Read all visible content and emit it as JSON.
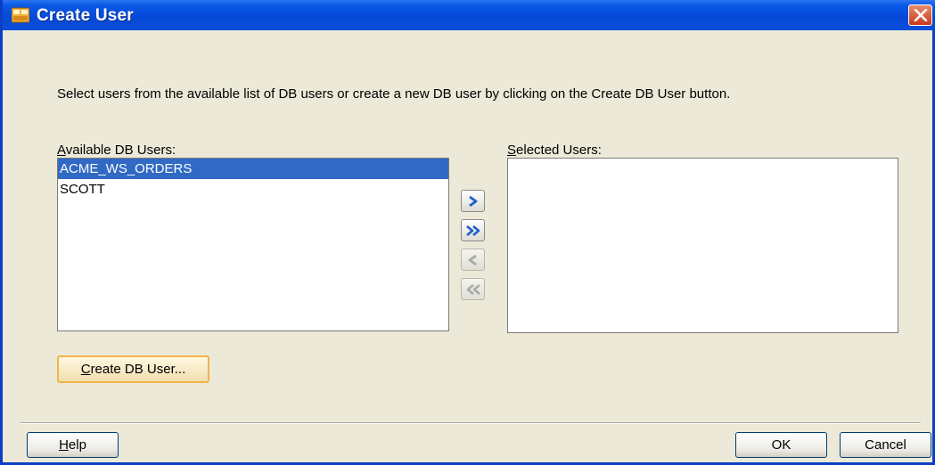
{
  "dialog": {
    "title": "Create User",
    "description": "Select users from the available list of DB users or create a new DB user by clicking on the Create DB User button."
  },
  "available": {
    "label_mnemonic": "A",
    "label_rest": "vailable DB Users:",
    "items": [
      {
        "label": "ACME_WS_ORDERS",
        "selected": true
      },
      {
        "label": "SCOTT",
        "selected": false
      }
    ]
  },
  "selected": {
    "label_mnemonic": "S",
    "label_rest": "elected Users:",
    "items": []
  },
  "move_buttons": [
    {
      "name": "move-right-button",
      "icon": "chevron-right-icon",
      "enabled": true
    },
    {
      "name": "move-all-right-button",
      "icon": "double-chevron-right-icon",
      "enabled": true
    },
    {
      "name": "move-left-button",
      "icon": "chevron-left-icon",
      "enabled": false
    },
    {
      "name": "move-all-left-button",
      "icon": "double-chevron-left-icon",
      "enabled": false
    }
  ],
  "buttons": {
    "create_db_user_mnemonic": "C",
    "create_db_user_rest": "reate DB User...",
    "help_mnemonic": "H",
    "help_rest": "elp",
    "ok": "OK",
    "cancel": "Cancel"
  },
  "colors": {
    "titlebar": "#0648d6",
    "dialog_bg": "#ece9d8",
    "selection": "#316ac5",
    "close": "#c9391b"
  }
}
